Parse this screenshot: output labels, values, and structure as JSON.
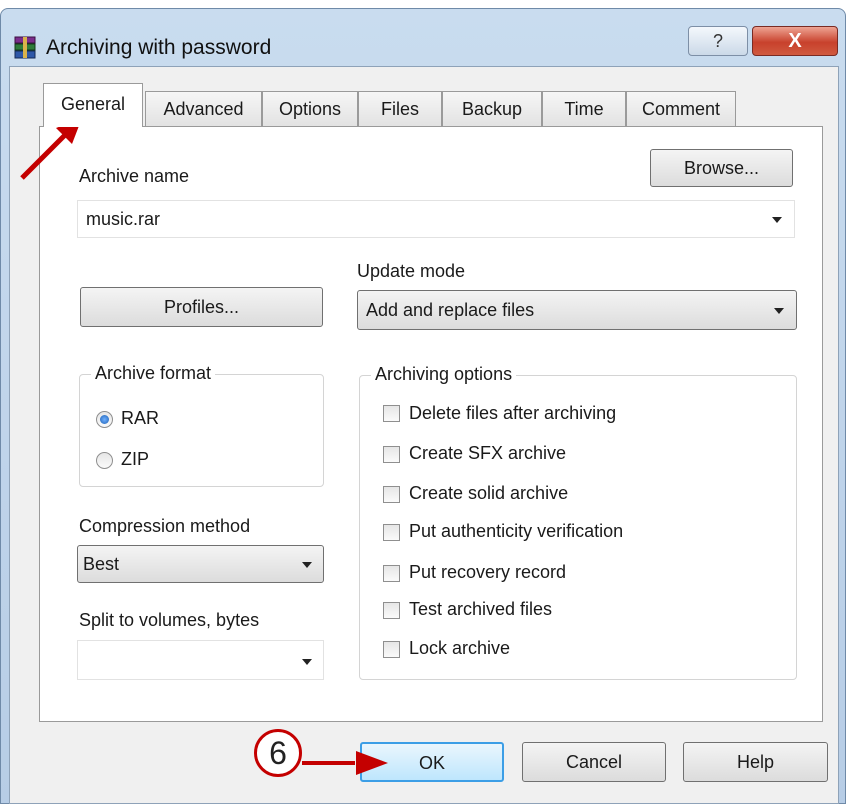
{
  "window": {
    "title": "Archiving with password",
    "help_glyph": "?",
    "close_glyph": "X"
  },
  "tabs": [
    {
      "label": "General",
      "active": true
    },
    {
      "label": "Advanced"
    },
    {
      "label": "Options"
    },
    {
      "label": "Files"
    },
    {
      "label": "Backup"
    },
    {
      "label": "Time"
    },
    {
      "label": "Comment"
    }
  ],
  "general": {
    "archive_name_label": "Archive name",
    "browse_label": "Browse...",
    "archive_name_value": "music.rar",
    "update_mode_label": "Update mode",
    "update_mode_value": "Add and replace files",
    "profiles_label": "Profiles...",
    "archive_format": {
      "title": "Archive format",
      "rar": "RAR",
      "zip": "ZIP",
      "selected": "RAR"
    },
    "compression_label": "Compression method",
    "compression_value": "Best",
    "split_label": "Split to volumes, bytes",
    "split_value": "",
    "archiving_options": {
      "title": "Archiving options",
      "items": [
        {
          "label": "Delete files after archiving",
          "checked": false
        },
        {
          "label": "Create SFX archive",
          "checked": false
        },
        {
          "label": "Create solid archive",
          "checked": false
        },
        {
          "label": "Put authenticity verification",
          "checked": false
        },
        {
          "label": "Put recovery record",
          "checked": false
        },
        {
          "label": "Test archived files",
          "checked": false
        },
        {
          "label": "Lock archive",
          "checked": false
        }
      ]
    }
  },
  "footer": {
    "ok_label": "OK",
    "cancel_label": "Cancel",
    "help_label": "Help",
    "step_number": "6"
  },
  "colors": {
    "annotation_red": "#c40000",
    "ok_focus": "#3c9ee6"
  }
}
